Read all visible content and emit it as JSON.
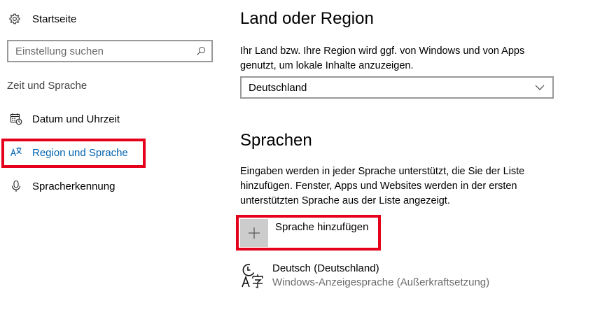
{
  "sidebar": {
    "home_label": "Startseite",
    "search_placeholder": "Einstellung suchen",
    "section_label": "Zeit und Sprache",
    "items": [
      {
        "label": "Datum und Uhrzeit",
        "icon": "calendar-clock-icon",
        "active": false
      },
      {
        "label": "Region und Sprache",
        "icon": "region-language-icon",
        "active": true
      },
      {
        "label": "Spracherkennung",
        "icon": "microphone-icon",
        "active": false
      }
    ]
  },
  "main": {
    "region_title": "Land oder Region",
    "region_description": "Ihr Land bzw. Ihre Region wird ggf. von Windows und von Apps genutzt, um lokale Inhalte anzuzeigen.",
    "region_value": "Deutschland",
    "languages_title": "Sprachen",
    "languages_description": "Eingaben werden in jeder Sprache unterstützt, die Sie der Liste hinzufügen. Fenster, Apps und Websites werden in der ersten unterstützten Sprache aus der Liste angezeigt.",
    "add_language_label": "Sprache hinzufügen",
    "languages": [
      {
        "name": "Deutsch (Deutschland)",
        "detail": "Windows-Anzeigesprache (Außerkraftsetzung)"
      }
    ]
  },
  "colors": {
    "accent": "#0063b1",
    "highlight": "#e4001b",
    "plus_box": "#cccccc"
  }
}
